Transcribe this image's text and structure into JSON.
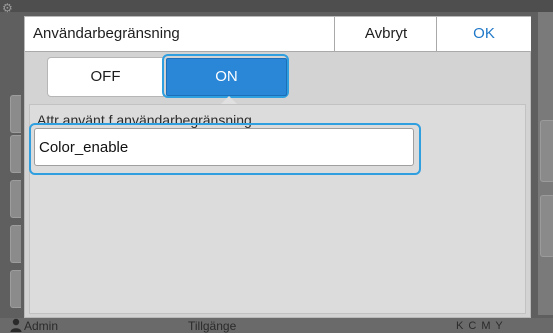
{
  "background": {
    "status_user": "Admin",
    "status_mid": "Tillgänge",
    "ink_labels": "K C M Y"
  },
  "dialog": {
    "title": "Användarbegränsning",
    "cancel_label": "Avbryt",
    "ok_label": "OK",
    "toggle": {
      "off_label": "OFF",
      "on_label": "ON",
      "selected": "ON"
    },
    "field": {
      "label": "Attr använt f användarbegränsning",
      "value": "Color_enable"
    }
  },
  "colors": {
    "accent": "#2a87d8",
    "focus_ring": "#2f9fe0",
    "ok_text": "#1f78c8"
  }
}
